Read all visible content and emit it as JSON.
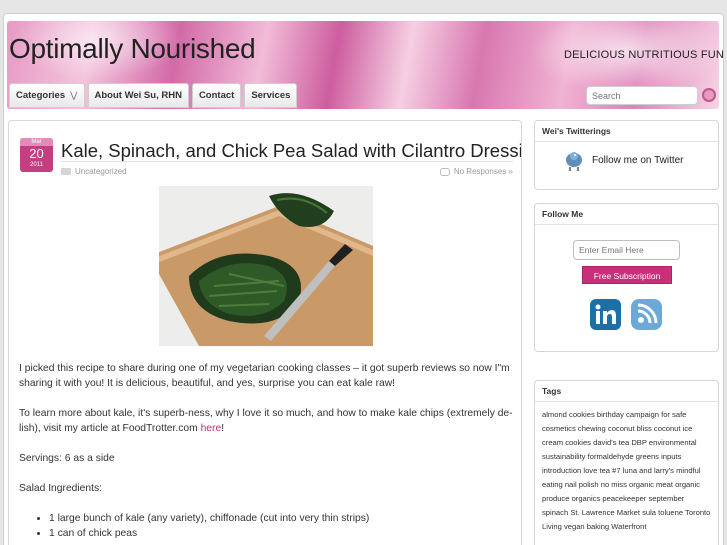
{
  "site": {
    "title": "Optimally Nourished",
    "tagline": "DELICIOUS NUTRITIOUS FUN"
  },
  "nav": {
    "items": [
      {
        "label": "Categories",
        "dropdown": true
      },
      {
        "label": "About Wei Su, RHN",
        "dropdown": false
      },
      {
        "label": "Contact",
        "dropdown": false
      },
      {
        "label": "Services",
        "dropdown": false
      }
    ],
    "search_placeholder": "Search"
  },
  "post": {
    "date": {
      "month": "Mar",
      "day": "20",
      "year": "2011"
    },
    "title": "Kale, Spinach, and Chick Pea Salad with Cilantro Dressing",
    "category": "Uncategorized",
    "comments": "No Responses »",
    "paragraphs": [
      {
        "text": "I picked this recipe to share during one of my vegetarian cooking classes – it got superb reviews so now I\"m sharing it with you! It is delicious, beautiful, and yes, surprise you can eat kale raw!"
      },
      {
        "text": "To learn more about kale, it's superb-ness, why I love it so much, and how to make kale chips (extremely de-lish), visit my article at FoodTrotter.com ",
        "link": "here",
        "after": "!"
      },
      {
        "text": "Servings: 6 as a side"
      },
      {
        "text": "Salad Ingredients:"
      }
    ],
    "ingredients": [
      "1 large bunch of kale (any variety), chiffonade (cut into very thin strips)",
      "1 can of chick peas"
    ]
  },
  "sidebar": {
    "twitter": {
      "title": "Wei's Twitterings",
      "follow_label": "Follow me on Twitter"
    },
    "follow": {
      "title": "Follow Me",
      "email_placeholder": "Enter Email Here",
      "subscribe_label": "Free Subscription"
    },
    "tags": {
      "title": "Tags",
      "items": [
        "almond cookies",
        "birthday",
        "campaign for safe cosmetics",
        "chewing",
        "coconut bliss",
        "coconut ice cream",
        "cookies",
        "david's tea",
        "DBP",
        "environmental sustainability",
        "formaldehyde",
        "greens",
        "inputs",
        "introduction",
        "love",
        "tea",
        "#7",
        "luna and larry's",
        "mindful eating",
        "nail polish",
        "no miss",
        "organic meat",
        "organic produce",
        "organics",
        "peacekeeper",
        "september",
        "spinach",
        "St. Lawrence Market",
        "sula",
        "toluene",
        "Toronto",
        "Living",
        "vegan baking",
        "Waterfront"
      ]
    }
  },
  "colors": {
    "accent": "#c8317a",
    "link": "#c0306f"
  }
}
